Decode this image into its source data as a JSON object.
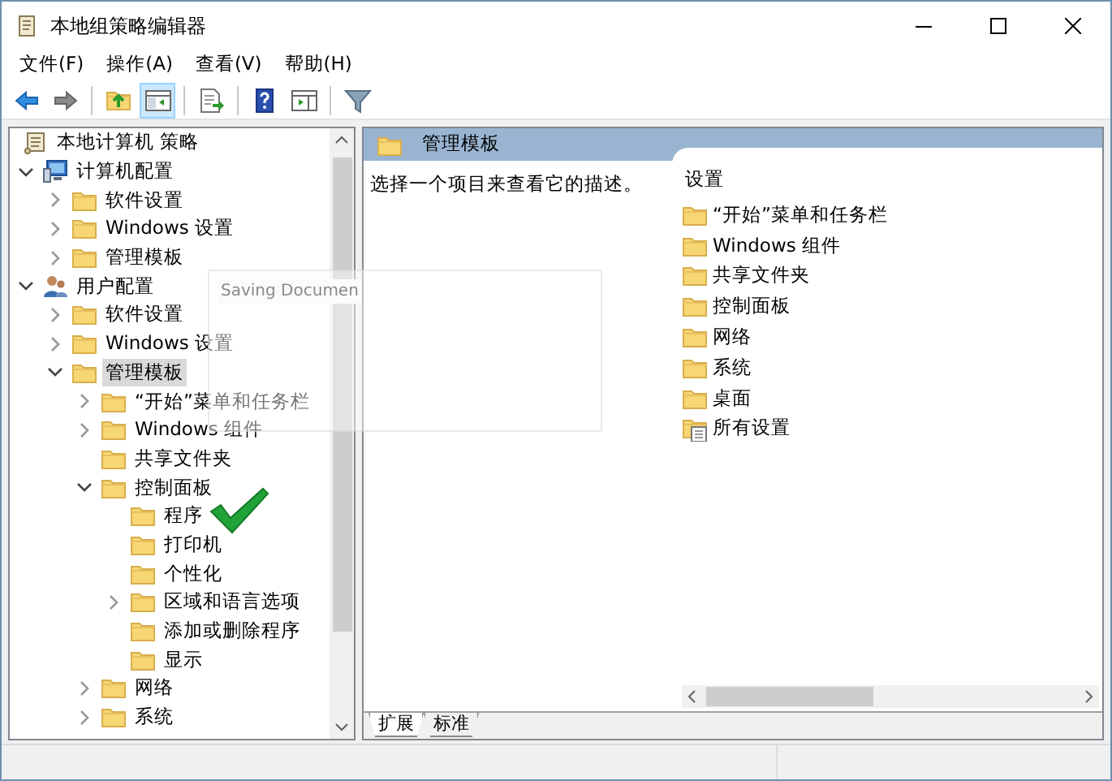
{
  "window": {
    "title": "本地组策略编辑器"
  },
  "menu": [
    "文件(F)",
    "操作(A)",
    "查看(V)",
    "帮助(H)"
  ],
  "toolbar": [
    {
      "kind": "back",
      "pressed": false
    },
    {
      "kind": "forward",
      "pressed": false
    },
    {
      "kind": "separator"
    },
    {
      "kind": "up",
      "pressed": false
    },
    {
      "kind": "tree",
      "pressed": true
    },
    {
      "kind": "separator"
    },
    {
      "kind": "export",
      "pressed": false
    },
    {
      "kind": "separator"
    },
    {
      "kind": "help",
      "pressed": false
    },
    {
      "kind": "pane",
      "pressed": false
    },
    {
      "kind": "separator"
    },
    {
      "kind": "filter",
      "pressed": false
    }
  ],
  "tree": {
    "label": "本地计算机 策略",
    "kind": "policy",
    "selected": false,
    "children": [
      {
        "label": "计算机配置",
        "kind": "computer",
        "selected": false,
        "expanded": true,
        "children": [
          {
            "label": "软件设置",
            "kind": "folder",
            "selected": false,
            "expanded": false
          },
          {
            "label": "Windows 设置",
            "kind": "folder",
            "selected": false,
            "expanded": false
          },
          {
            "label": "管理模板",
            "kind": "folder",
            "selected": false,
            "expanded": false
          }
        ]
      },
      {
        "label": "用户配置",
        "kind": "user",
        "selected": false,
        "expanded": true,
        "children": [
          {
            "label": "软件设置",
            "kind": "folder",
            "selected": false,
            "expanded": false
          },
          {
            "label": "Windows 设置",
            "kind": "folder",
            "selected": false,
            "expanded": false
          },
          {
            "label": "管理模板",
            "kind": "folder",
            "selected": true,
            "expanded": true,
            "children": [
              {
                "label": "“开始”菜单和任务栏",
                "kind": "folder",
                "selected": false,
                "expanded": false
              },
              {
                "label": "Windows 组件",
                "kind": "folder",
                "selected": false,
                "expanded": false
              },
              {
                "label": "共享文件夹",
                "kind": "folder",
                "selected": false
              },
              {
                "label": "控制面板",
                "kind": "folder",
                "selected": false,
                "expanded": true,
                "children": [
                  {
                    "label": "程序",
                    "kind": "folder",
                    "selected": false
                  },
                  {
                    "label": "打印机",
                    "kind": "folder",
                    "selected": false
                  },
                  {
                    "label": "个性化",
                    "kind": "folder",
                    "selected": false
                  },
                  {
                    "label": "区域和语言选项",
                    "kind": "folder",
                    "selected": false,
                    "expanded": false
                  },
                  {
                    "label": "添加或删除程序",
                    "kind": "folder",
                    "selected": false
                  },
                  {
                    "label": "显示",
                    "kind": "folder",
                    "selected": false
                  }
                ]
              },
              {
                "label": "网络",
                "kind": "folder",
                "selected": false,
                "expanded": false
              },
              {
                "label": "系统",
                "kind": "folder",
                "selected": false,
                "expanded": false
              }
            ]
          }
        ]
      }
    ]
  },
  "header": {
    "title": "管理模板"
  },
  "description": "选择一个项目来查看它的描述。",
  "settings": {
    "heading": "设置",
    "items": [
      {
        "kind": "folder",
        "label": "“开始”菜单和任务栏"
      },
      {
        "kind": "folder",
        "label": "Windows 组件"
      },
      {
        "kind": "folder",
        "label": "共享文件夹"
      },
      {
        "kind": "folder",
        "label": "控制面板"
      },
      {
        "kind": "folder",
        "label": "网络"
      },
      {
        "kind": "folder",
        "label": "系统"
      },
      {
        "kind": "folder",
        "label": "桌面"
      },
      {
        "kind": "all",
        "label": "所有设置"
      }
    ]
  },
  "tabs": [
    {
      "label": "扩展",
      "selected": true
    },
    {
      "label": "标准",
      "selected": false
    }
  ],
  "overlay": {
    "title": "Saving Documen"
  }
}
